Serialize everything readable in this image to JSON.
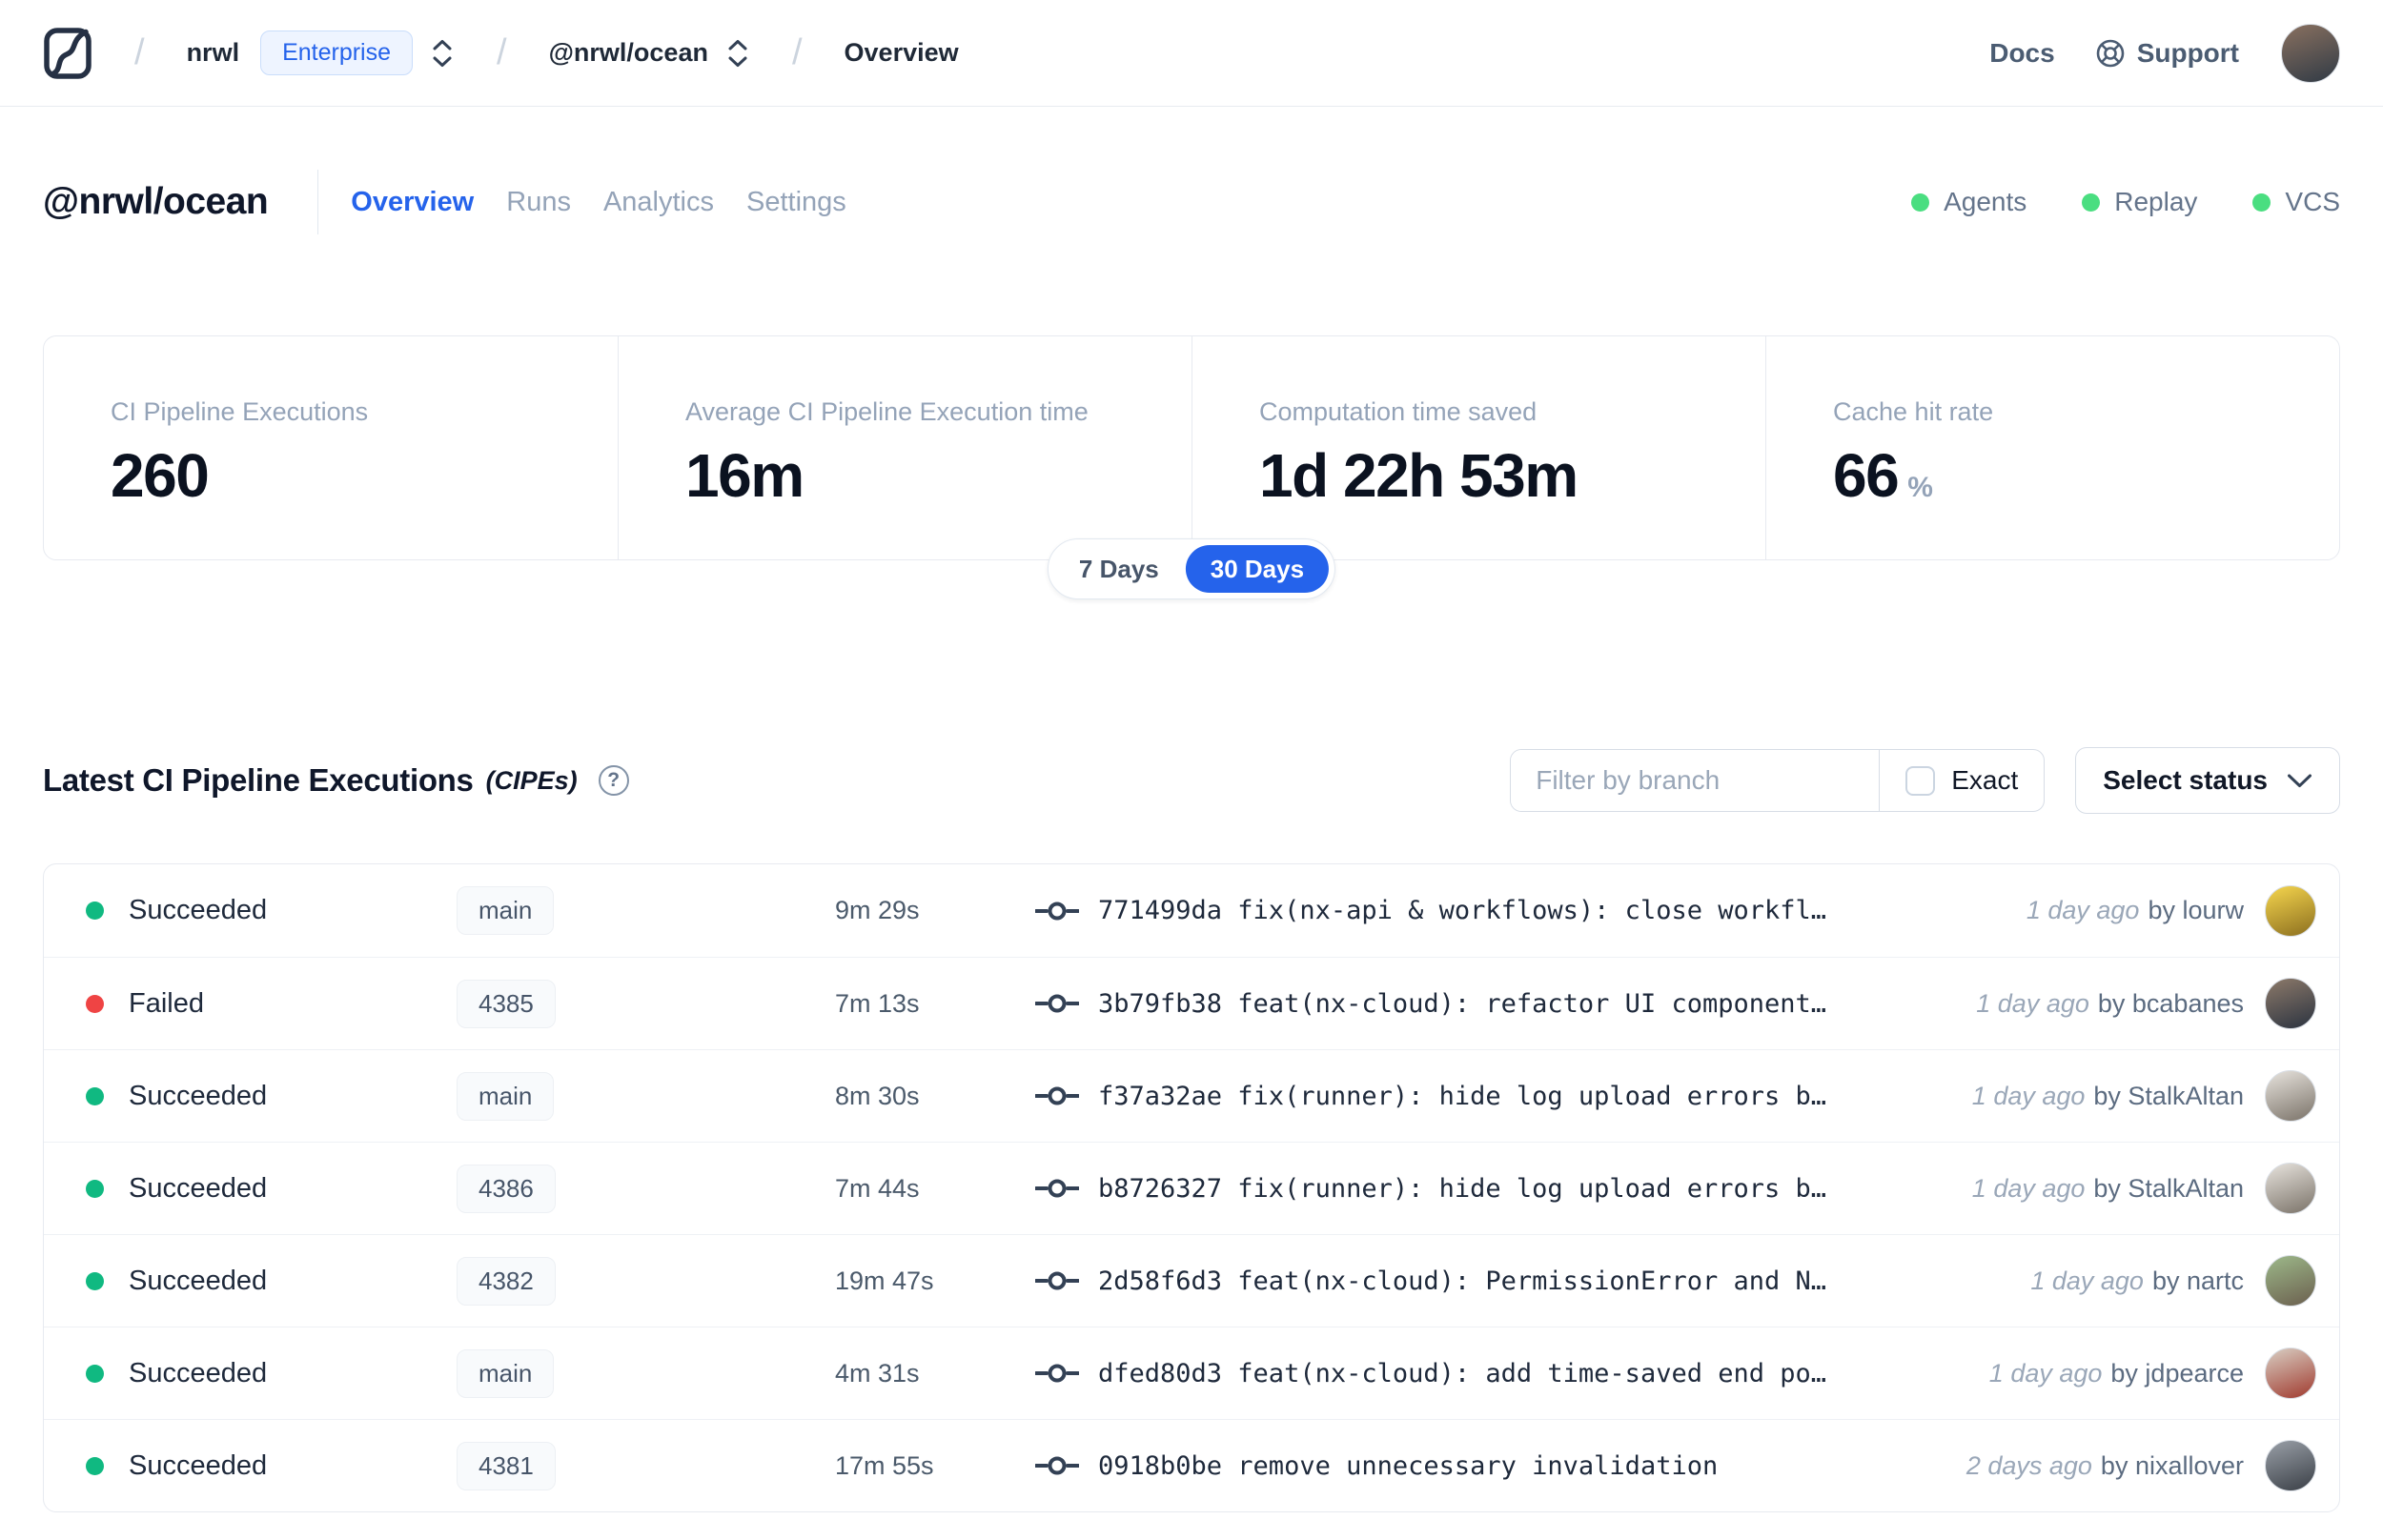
{
  "navbar": {
    "org": "nrwl",
    "org_badge": "Enterprise",
    "workspace": "@nrwl/ocean",
    "page": "Overview",
    "docs_label": "Docs",
    "support_label": "Support",
    "avatar_colors": [
      "#8a7160",
      "#303a45"
    ]
  },
  "header": {
    "title": "@nrwl/ocean",
    "tabs": [
      {
        "label": "Overview",
        "active": true
      },
      {
        "label": "Runs",
        "active": false
      },
      {
        "label": "Analytics",
        "active": false
      },
      {
        "label": "Settings",
        "active": false
      }
    ],
    "statuses": [
      {
        "label": "Agents",
        "state": "online"
      },
      {
        "label": "Replay",
        "state": "online"
      },
      {
        "label": "VCS",
        "state": "online"
      }
    ]
  },
  "stats": {
    "cards": [
      {
        "label": "CI Pipeline Executions",
        "value": "260"
      },
      {
        "label": "Average CI Pipeline Execution time",
        "value": "16m"
      },
      {
        "label": "Computation time saved",
        "value": "1d 22h 53m"
      },
      {
        "label": "Cache hit rate",
        "value": "66",
        "unit": "%"
      }
    ],
    "range_toggle": {
      "options": [
        "7 Days",
        "30 Days"
      ],
      "selected": "30 Days"
    }
  },
  "section": {
    "title": "Latest CI Pipeline Executions",
    "subtitle": "(CIPEs)",
    "help_glyph": "?",
    "filter_placeholder": "Filter by branch",
    "exact_label": "Exact",
    "exact_checked": false,
    "status_select_label": "Select status"
  },
  "table": {
    "rows": [
      {
        "status": "Succeeded",
        "status_color": "#10b981",
        "branch": "main",
        "duration": "9m 29s",
        "commit": "771499da fix(nx-api & workflows): close workfl…",
        "time": "1 day ago",
        "author": "by lourw",
        "avatar_colors": [
          "#f6d64e",
          "#8c6f1f"
        ]
      },
      {
        "status": "Failed",
        "status_color": "#ef4444",
        "branch": "4385",
        "duration": "7m 13s",
        "commit": "3b79fb38 feat(nx-cloud): refactor UI component…",
        "time": "1 day ago",
        "author": "by bcabanes",
        "avatar_colors": [
          "#8d7a6a",
          "#2b3340"
        ]
      },
      {
        "status": "Succeeded",
        "status_color": "#10b981",
        "branch": "main",
        "duration": "8m 30s",
        "commit": "f37a32ae fix(runner): hide log upload errors b…",
        "time": "1 day ago",
        "author": "by StalkAltan",
        "avatar_colors": [
          "#e8e4de",
          "#7a7268"
        ]
      },
      {
        "status": "Succeeded",
        "status_color": "#10b981",
        "branch": "4386",
        "duration": "7m 44s",
        "commit": "b8726327 fix(runner): hide log upload errors b…",
        "time": "1 day ago",
        "author": "by StalkAltan",
        "avatar_colors": [
          "#e8e4de",
          "#7a7268"
        ]
      },
      {
        "status": "Succeeded",
        "status_color": "#10b981",
        "branch": "4382",
        "duration": "19m 47s",
        "commit": "2d58f6d3 feat(nx-cloud): PermissionError and N…",
        "time": "1 day ago",
        "author": "by nartc",
        "avatar_colors": [
          "#9db98a",
          "#6b5f4e"
        ]
      },
      {
        "status": "Succeeded",
        "status_color": "#10b981",
        "branch": "main",
        "duration": "4m 31s",
        "commit": "dfed80d3 feat(nx-cloud): add time-saved end po…",
        "time": "1 day ago",
        "author": "by jdpearce",
        "avatar_colors": [
          "#d9cfc4",
          "#a03a2e"
        ]
      },
      {
        "status": "Succeeded",
        "status_color": "#10b981",
        "branch": "4381",
        "duration": "17m 55s",
        "commit": "0918b0be remove unnecessary invalidation",
        "time": "2 days ago",
        "author": "by nixallover",
        "avatar_colors": [
          "#9aa0a8",
          "#3a3f46"
        ]
      }
    ]
  },
  "colors": {
    "accent_blue": "#2563eb",
    "success_green": "#10b981",
    "failed_red": "#ef4444",
    "online_dot_green": "#4ade80"
  }
}
